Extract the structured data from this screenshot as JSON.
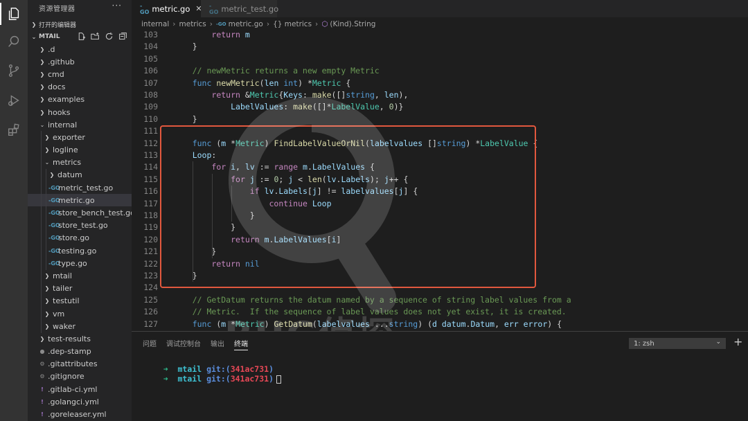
{
  "explorer": {
    "title": "资源管理器",
    "more": "···",
    "open_editors": "打开的编辑器",
    "project": "MTAIL"
  },
  "tree": [
    {
      "label": ".d",
      "indent": 0,
      "kind": "folder"
    },
    {
      "label": ".github",
      "indent": 0,
      "kind": "folder"
    },
    {
      "label": "cmd",
      "indent": 0,
      "kind": "folder"
    },
    {
      "label": "docs",
      "indent": 0,
      "kind": "folder"
    },
    {
      "label": "examples",
      "indent": 0,
      "kind": "folder"
    },
    {
      "label": "hooks",
      "indent": 0,
      "kind": "folder"
    },
    {
      "label": "internal",
      "indent": 0,
      "kind": "folder-open"
    },
    {
      "label": "exporter",
      "indent": 1,
      "kind": "folder"
    },
    {
      "label": "logline",
      "indent": 1,
      "kind": "folder"
    },
    {
      "label": "metrics",
      "indent": 1,
      "kind": "folder-open"
    },
    {
      "label": "datum",
      "indent": 2,
      "kind": "folder"
    },
    {
      "label": "metric_test.go",
      "indent": 2,
      "kind": "go"
    },
    {
      "label": "metric.go",
      "indent": 2,
      "kind": "go",
      "selected": true
    },
    {
      "label": "store_bench_test.go",
      "indent": 2,
      "kind": "go"
    },
    {
      "label": "store_test.go",
      "indent": 2,
      "kind": "go"
    },
    {
      "label": "store.go",
      "indent": 2,
      "kind": "go"
    },
    {
      "label": "testing.go",
      "indent": 2,
      "kind": "go"
    },
    {
      "label": "type.go",
      "indent": 2,
      "kind": "go"
    },
    {
      "label": "mtail",
      "indent": 1,
      "kind": "folder"
    },
    {
      "label": "tailer",
      "indent": 1,
      "kind": "folder"
    },
    {
      "label": "testutil",
      "indent": 1,
      "kind": "folder"
    },
    {
      "label": "vm",
      "indent": 1,
      "kind": "folder"
    },
    {
      "label": "waker",
      "indent": 1,
      "kind": "folder"
    },
    {
      "label": "test-results",
      "indent": 0,
      "kind": "folder"
    },
    {
      "label": ".dep-stamp",
      "indent": 0,
      "kind": "dot"
    },
    {
      "label": ".gitattributes",
      "indent": 0,
      "kind": "gear"
    },
    {
      "label": ".gitignore",
      "indent": 0,
      "kind": "gear"
    },
    {
      "label": ".gitlab-ci.yml",
      "indent": 0,
      "kind": "yml"
    },
    {
      "label": ".golangci.yml",
      "indent": 0,
      "kind": "yml"
    },
    {
      "label": ".goreleaser.yml",
      "indent": 0,
      "kind": "yml"
    }
  ],
  "tabs": [
    {
      "label": "metric.go",
      "active": true
    },
    {
      "label": "metric_test.go",
      "active": false
    }
  ],
  "breadcrumb": [
    "internal",
    "metrics",
    "metric.go",
    "{} metrics",
    "(Kind).String"
  ],
  "code": [
    {
      "n": "103",
      "text": "        return m"
    },
    {
      "n": "104",
      "text": "    }"
    },
    {
      "n": "105",
      "text": ""
    },
    {
      "n": "106",
      "text": "    // newMetric returns a new empty Metric"
    },
    {
      "n": "107",
      "text": "    func newMetric(len int) *Metric {"
    },
    {
      "n": "108",
      "text": "        return &Metric{Keys: make([]string, len),"
    },
    {
      "n": "109",
      "text": "            LabelValues: make([]*LabelValue, 0)}"
    },
    {
      "n": "110",
      "text": "    }"
    },
    {
      "n": "111",
      "text": ""
    },
    {
      "n": "112",
      "text": "    func (m *Metric) FindLabelValueOrNil(labelvalues []string) *LabelValue {"
    },
    {
      "n": "113",
      "text": "    Loop:"
    },
    {
      "n": "114",
      "text": "        for i, lv := range m.LabelValues {"
    },
    {
      "n": "115",
      "text": "            for j := 0; j < len(lv.Labels); j++ {"
    },
    {
      "n": "116",
      "text": "                if lv.Labels[j] != labelvalues[j] {"
    },
    {
      "n": "117",
      "text": "                    continue Loop"
    },
    {
      "n": "118",
      "text": "                }"
    },
    {
      "n": "119",
      "text": "            }"
    },
    {
      "n": "120",
      "text": "            return m.LabelValues[i]"
    },
    {
      "n": "121",
      "text": "        }"
    },
    {
      "n": "122",
      "text": "        return nil"
    },
    {
      "n": "123",
      "text": "    }"
    },
    {
      "n": "124",
      "text": ""
    },
    {
      "n": "125",
      "text": "    // GetDatum returns the datum named by a sequence of string label values from a"
    },
    {
      "n": "126",
      "text": "    // Metric.  If the sequence of label values does not yet exist, it is created."
    },
    {
      "n": "127",
      "text": "    func (m *Metric) GetDatum(labelvalues ...string) (d datum.Datum, err error) {"
    }
  ],
  "panel": {
    "tabs": [
      "问题",
      "调试控制台",
      "输出",
      "终端"
    ],
    "active_tab": "终端",
    "terminal_select": "1: zsh",
    "plus": "+"
  },
  "terminal": [
    {
      "arrow": "➜",
      "dir": "mtail",
      "git": "git:(",
      "branch": "341ac731",
      "close": ")"
    },
    {
      "arrow": "➜",
      "dir": "mtail",
      "git": "git:(",
      "branch": "341ac731",
      "close": ")"
    }
  ],
  "watermark": "BUG侦探",
  "colors": {
    "highlight_border": "#e2583e",
    "selected_row": "#37373d",
    "go_icon": "#519aba"
  }
}
